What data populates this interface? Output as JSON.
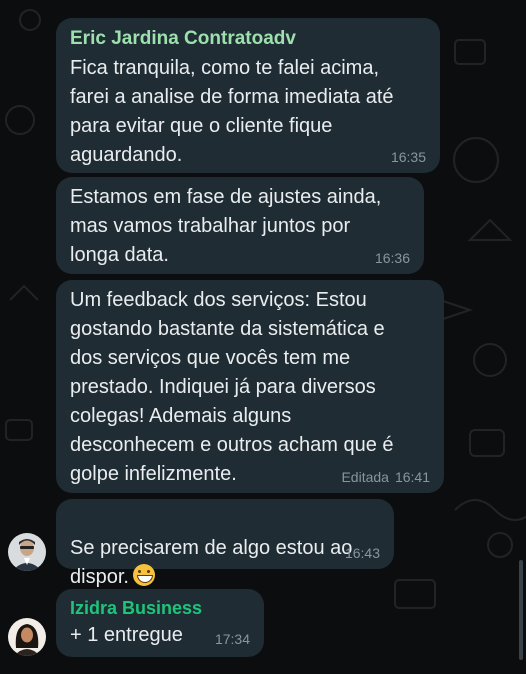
{
  "messages": [
    {
      "sender": "Eric Jardina Contratoadv",
      "sender_color": "#9de0ad",
      "text": "Fica tranquila, como te falei acima,\nfarei a analise de forma imediata até\npara evitar que o cliente fique\naguardando.",
      "time": "16:35"
    },
    {
      "text": "Estamos em fase de ajustes ainda,\nmas vamos trabalhar juntos por\nlonga data.",
      "time": "16:36"
    },
    {
      "text": "Um feedback dos serviços: Estou\ngostando bastante da sistemática e\ndos serviços que vocês tem me\nprestado. Indiquei já para diversos\ncolegas! Ademais alguns\ndesconhecem e outros acham que é\ngolpe infelizmente.",
      "edited_label": "Editada",
      "time": "16:41"
    },
    {
      "text": "Se precisarem de algo estou ao\ndispor.",
      "emoji": "grinning-face-emoji",
      "time": "16:43"
    },
    {
      "sender": "Izidra Business",
      "sender_color": "#1fc47a",
      "text": "+ 1 entregue",
      "time": "17:34"
    }
  ],
  "colors": {
    "background": "#0b0d0f",
    "bubble": "#202c33",
    "text": "#e9edef",
    "meta": "#8696a0"
  }
}
